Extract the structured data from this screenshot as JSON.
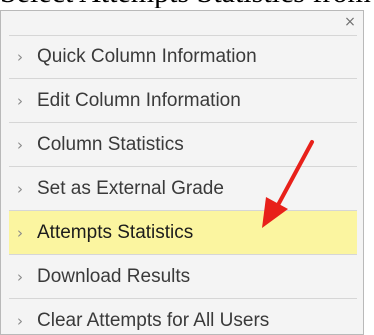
{
  "page_heading": "Select Attempts Statistics from",
  "panel": {
    "close_glyph": "×",
    "items": [
      {
        "label": "Quick Column Information",
        "highlighted": false
      },
      {
        "label": "Edit Column Information",
        "highlighted": false
      },
      {
        "label": "Column Statistics",
        "highlighted": false
      },
      {
        "label": "Set as External Grade",
        "highlighted": false
      },
      {
        "label": "Attempts Statistics",
        "highlighted": true
      },
      {
        "label": "Download Results",
        "highlighted": false
      },
      {
        "label": "Clear Attempts for All Users",
        "highlighted": false
      }
    ]
  },
  "icons": {
    "close": "close-icon",
    "item_marker": "chevron-right-icon",
    "annotation": "red-arrow-icon"
  },
  "colors": {
    "highlight": "#fbf5a0",
    "arrow": "#e8201a",
    "panel_bg": "#f4f4f4"
  }
}
